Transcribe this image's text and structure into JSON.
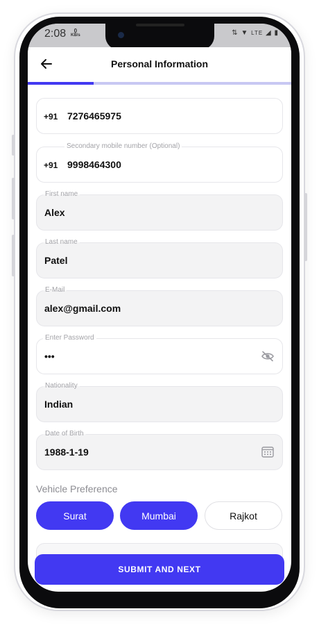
{
  "status_bar": {
    "time": "2:08",
    "kbs_value": "0",
    "kbs_unit": "KB/s",
    "network": "LTE"
  },
  "header": {
    "title": "Personal Information",
    "progress_fraction": 0.25
  },
  "fields": {
    "primary_mobile": {
      "prefix": "+91",
      "value": "7276465975"
    },
    "secondary_mobile": {
      "label": "Secondary mobile number (Optional)",
      "prefix": "+91",
      "value": "9998464300"
    },
    "first_name": {
      "label": "First name",
      "value": "Alex"
    },
    "last_name": {
      "label": "Last name",
      "value": "Patel"
    },
    "email": {
      "label": "E-Mail",
      "value": "alex@gmail.com"
    },
    "password": {
      "label": "Enter Password",
      "value": "•••"
    },
    "nationality": {
      "label": "Nationality",
      "value": "Indian"
    },
    "dob": {
      "label": "Date of Birth",
      "value": "1988-1-19"
    }
  },
  "vehicle_preference": {
    "title": "Vehicle Preference",
    "options": [
      {
        "label": "Surat",
        "selected": true
      },
      {
        "label": "Mumbai",
        "selected": true
      },
      {
        "label": "Rajkot",
        "selected": false
      }
    ]
  },
  "submit": {
    "label": "SUBMIT AND NEXT"
  },
  "colors": {
    "accent": "#4239f2",
    "progress_track": "#c8c8f3",
    "field_fill": "#f3f3f4"
  }
}
